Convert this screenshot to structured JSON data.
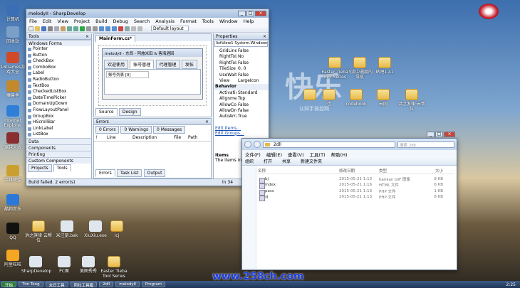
{
  "desktop_left": [
    {
      "label": "计算机",
      "color": "#3b6fb5"
    },
    {
      "label": "回收站",
      "color": "#7aa0c8"
    },
    {
      "label": "18Games游戏大全",
      "color": "#d04a2a"
    },
    {
      "label": "魔兽争",
      "color": "#c28a2a"
    },
    {
      "label": "Internet Explorer",
      "color": "#2f7fd8"
    },
    {
      "label": "穿越火线",
      "color": "#8a2f2f"
    },
    {
      "label": "英雄联盟",
      "color": "#c9a030"
    },
    {
      "label": "酷狗音乐",
      "color": "#2b78d8"
    },
    {
      "label": "QQ",
      "color": "#111111"
    },
    {
      "label": "阿里旺旺",
      "color": "#f5a623"
    }
  ],
  "desktop_bottom": [
    {
      "label": "洪之旗律·云帮位",
      "folder": true
    },
    {
      "label": "米注册.bak",
      "folder": false
    },
    {
      "label": "XiuXiu.exe",
      "folder": false
    },
    {
      "label": "lcj",
      "folder": true
    },
    {
      "label": "Sniffer 中文版",
      "folder": false
    },
    {
      "label": "CookieGetx",
      "folder": false
    },
    {
      "label": "CookieFilter",
      "folder": false
    },
    {
      "label": "bjDJ",
      "folder": false
    },
    {
      "label": "SharpDevelop",
      "folder": false
    },
    {
      "label": "PC面",
      "folder": false
    },
    {
      "label": "美图秀秀",
      "folder": false
    },
    {
      "label": "Easter Tieba Tool Series",
      "folder": true
    }
  ],
  "desktop_right": [
    {
      "label": "Easter Tieba Tool Series"
    },
    {
      "label": "飞流中通度的导航"
    },
    {
      "label": "贴吧1.41"
    },
    {
      "label": ""
    },
    {
      "label": "也"
    },
    {
      "label": "codebook"
    },
    {
      "label": "云网"
    },
    {
      "label": "洪之发律·云帮位"
    }
  ],
  "watermark": {
    "big": "快乐",
    "small": "认知手操控网"
  },
  "url_watermark": "www.258ch.com",
  "ide": {
    "title": "melodyII - SharpDevelop",
    "menus": [
      "File",
      "Edit",
      "View",
      "Project",
      "Build",
      "Debug",
      "Search",
      "Analysis",
      "Format",
      "Tools",
      "Window",
      "Help"
    ],
    "layout_select": "Default layout",
    "tools": {
      "header": "Tools",
      "section": "Windows Forms",
      "items": [
        "Pointer",
        "Button",
        "CheckBox",
        "ComboBox",
        "Label",
        "RadioButton",
        "TextBox",
        "CheckedListBox",
        "DateTimePicker",
        "DomainUpDown",
        "FlowLayoutPanel",
        "GroupBox",
        "HScrollBar",
        "LinkLabel",
        "ListBox"
      ],
      "categories": [
        "Data",
        "Components",
        "Printing",
        "Custom Components"
      ],
      "bottom_tabs": [
        "Projects",
        "Tools"
      ]
    },
    "designer": {
      "tab": "MainForm.cs*",
      "form_title": "melodyII - 东西 - 阿施米田 & 客海酒回",
      "form_tabs": [
        "欢迎使用",
        "账号管理",
        "代理管理",
        "发帖"
      ],
      "field_label": "账号列表 [0]",
      "bottom_tabs": [
        "Source",
        "Design"
      ]
    },
    "errors": {
      "header": "Errors",
      "filters": [
        "0 Errors",
        "0 Warnings",
        "0 Messages"
      ],
      "columns": [
        "!",
        "Line",
        "Description",
        "File",
        "Path"
      ],
      "bottom_tabs": [
        "Errors",
        "Task List",
        "Output"
      ]
    },
    "properties": {
      "header": "Properties",
      "object": "listView1",
      "type": "System.Windows.F",
      "rows": [
        {
          "k": "GridLines",
          "v": "False"
        },
        {
          "k": "RightToLeft",
          "v": "No"
        },
        {
          "k": "RightToLeftL",
          "v": "False"
        },
        {
          "k": "TileSize",
          "v": "0, 0"
        },
        {
          "k": "UseWaitCu",
          "v": "False"
        },
        {
          "k": "View",
          "v": "LargeIcon"
        }
      ],
      "behavior_label": "Behavior",
      "behavior_rows": [
        {
          "k": "Activation",
          "v": "Standard"
        },
        {
          "k": "Alignment",
          "v": "Top"
        },
        {
          "k": "AllowColun",
          "v": "False"
        },
        {
          "k": "AllowDrop",
          "v": "False"
        },
        {
          "k": "AutoArrange",
          "v": "True"
        }
      ],
      "links": [
        "Edit Items...",
        "Edit Groups..."
      ],
      "desc_title": "Items",
      "desc_text": "The items in"
    },
    "status": {
      "left": "Build failed. 2 error(s)",
      "right": "ln 34"
    }
  },
  "explorer": {
    "path": "2dll",
    "search_placeholder": "搜索 2dll",
    "menus": [
      "文件(F)",
      "编辑(E)",
      "查看(V)",
      "工具(T)",
      "帮助(H)"
    ],
    "toolbar": [
      "组织",
      "打开",
      "共享",
      "新建文件夹"
    ],
    "columns": [
      "名称",
      "修改日期",
      "类型",
      "大小"
    ],
    "files": [
      {
        "name": "bj",
        "date": "2015-05-21 1:13",
        "type": "Kankan GIF 图像",
        "size": "8 KB"
      },
      {
        "name": "index",
        "date": "2015-05-21 1:16",
        "type": "HTML 文件",
        "size": "6 KB"
      },
      {
        "name": "pass",
        "date": "2015-05-21 1:13",
        "type": "PHP 文件",
        "size": "1 KB"
      },
      {
        "name": "sj",
        "date": "2015-05-21 1:13",
        "type": "PHP 文件",
        "size": "8 KB"
      }
    ]
  },
  "taskbar": {
    "items": [
      "开始",
      "Tim Teng",
      "未日工具",
      "阿拉工具箱",
      "2dll",
      "melodyII",
      "Program"
    ],
    "time": "2:25"
  }
}
